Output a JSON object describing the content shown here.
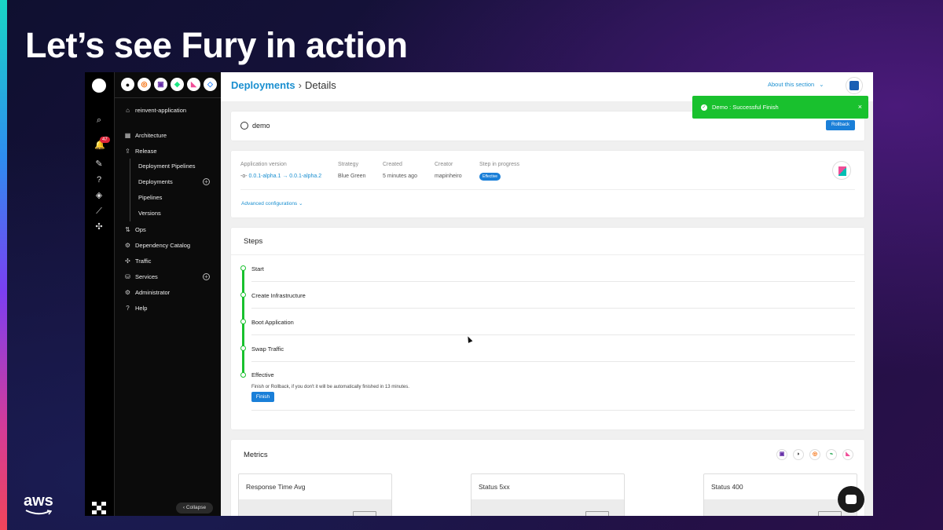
{
  "slide": {
    "title": "Let’s see Fury in action",
    "logo_text": "aws"
  },
  "colors": {
    "accent": "#1a8fd0",
    "success": "#19c12e",
    "button": "#1a7fd8",
    "sidebar": "#0b0b0b"
  },
  "rail": {
    "icons": [
      "search-icon",
      "bell-icon",
      "pencil-icon",
      "help-circle-icon",
      "cube-icon",
      "chart-icon",
      "puzzle-icon"
    ],
    "notification_count": "47"
  },
  "sidebar": {
    "integration_icons": [
      "github-icon",
      "grafana-icon",
      "datadog-icon",
      "newrelic-icon",
      "kibana-icon",
      "jira-icon"
    ],
    "app_name": "reinvent-application",
    "items": [
      {
        "label": "Architecture",
        "icon": "layout-icon"
      },
      {
        "label": "Release",
        "icon": "upload-icon"
      },
      {
        "label": "Ops",
        "icon": "arrows-icon"
      },
      {
        "label": "Dependency Catalog",
        "icon": "catalog-icon"
      },
      {
        "label": "Traffic",
        "icon": "traffic-icon"
      },
      {
        "label": "Services",
        "icon": "services-icon"
      },
      {
        "label": "Administrator",
        "icon": "gear-icon"
      },
      {
        "label": "Help",
        "icon": "help-icon"
      }
    ],
    "release_sub": [
      "Deployment Pipelines",
      "Deployments",
      "Pipelines",
      "Versions"
    ],
    "collapse_label": "Collapse"
  },
  "header": {
    "breadcrumb_link": "Deployments",
    "breadcrumb_sep": "›",
    "breadcrumb_current": "Details",
    "about_label": "About this section"
  },
  "toast": {
    "message": "Demo : Successful Finish",
    "close": "×"
  },
  "deployment": {
    "name": "demo",
    "rollback_label": "Rollback"
  },
  "info": {
    "headers": {
      "version": "Application version",
      "strategy": "Strategy",
      "created": "Created",
      "creator": "Creator",
      "step": "Step in progress"
    },
    "version_value": "0.0.1-alpha.1 → 0.0.1-alpha.2",
    "strategy_value": "Blue Green",
    "created_value": "5 minutes ago",
    "creator_value": "mapinheiro",
    "step_value": "Effective",
    "advanced_label": "Advanced configurations"
  },
  "steps": {
    "title": "Steps",
    "items": [
      "Start",
      "Create Infrastructure",
      "Boot Application",
      "Swap Traffic",
      "Effective"
    ],
    "note": "Finish or Rollback, if you don't it will be automatically finished in 13 minutes.",
    "finish_label": "Finish"
  },
  "metrics": {
    "title": "Metrics",
    "icons": [
      "datadog-icon",
      "newrelic-icon",
      "grafana-icon",
      "prometheus-icon",
      "kibana-icon"
    ],
    "cards": [
      "Response Time Avg",
      "Status 5xx",
      "Status 400"
    ]
  }
}
